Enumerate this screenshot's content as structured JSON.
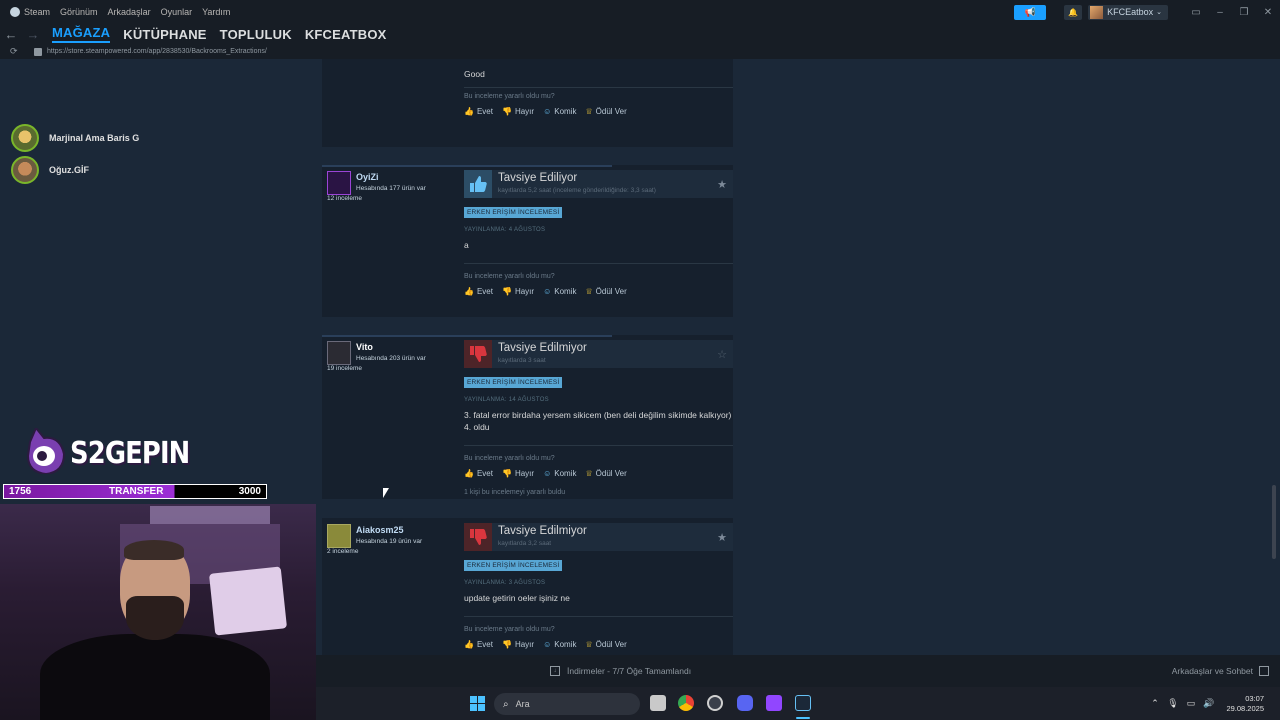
{
  "menu_bar": {
    "items": [
      "Steam",
      "Görünüm",
      "Arkadaşlar",
      "Oyunlar",
      "Yardım"
    ],
    "account_name": "KFCEatbox"
  },
  "nav": {
    "tabs": [
      "MAĞAZA",
      "KÜTÜPHANE",
      "TOPLULUK",
      "KFCEATBOX"
    ],
    "active_tab": "MAĞAZA",
    "url": "https://store.steampowered.com/app/2838530/Backrooms_Extractions/"
  },
  "friends": [
    {
      "name": "Marjinal Ama Baris G"
    },
    {
      "name": "Oğuz.GİF"
    }
  ],
  "partial_review": {
    "body": "Good",
    "helpful_question": "Bu inceleme yararlı oldu mu?",
    "actions": [
      "Evet",
      "Hayır",
      "Komik",
      "Ödül Ver"
    ]
  },
  "reviews": [
    {
      "user": "OyiZi",
      "games": "Hesabında 177 ürün var",
      "review_count": "12 inceleme",
      "verdict": "Tavsiye Ediliyor",
      "recommended": true,
      "hours": "kayıtlarda 5,2 saat (inceleme gönderildiğinde: 3,3 saat)",
      "badge": "ERKEN ERİŞİM İNCELEMESİ",
      "posted": "YAYINLANMA: 4 AĞUSTOS",
      "body": "a",
      "helpful_question": "Bu inceleme yararlı oldu mu?",
      "actions": [
        "Evet",
        "Hayır",
        "Komik",
        "Ödül Ver"
      ],
      "helpful_count": ""
    },
    {
      "user": "Vito",
      "games": "Hesabında 203 ürün var",
      "review_count": "19 inceleme",
      "verdict": "Tavsiye Edilmiyor",
      "recommended": false,
      "hours": "kayıtlarda 3 saat",
      "badge": "ERKEN ERİŞİM İNCELEMESİ",
      "posted": "YAYINLANMA: 14 AĞUSTOS",
      "body": "3. fatal error birdaha yersem sikicem (ben deli değilim sikimde kalkıyor) 4. oldu",
      "helpful_question": "Bu inceleme yararlı oldu mu?",
      "actions": [
        "Evet",
        "Hayır",
        "Komik",
        "Ödül Ver"
      ],
      "helpful_count": "1 kişi bu incelemeyi yararlı buldu"
    },
    {
      "user": "Aiakosm25",
      "games": "Hesabında 19 ürün var",
      "review_count": "2 inceleme",
      "verdict": "Tavsiye Edilmiyor",
      "recommended": false,
      "hours": "kayıtlarda 3,2 saat",
      "badge": "ERKEN ERİŞİM İNCELEMESİ",
      "posted": "YAYINLANMA: 3 AĞUSTOS",
      "body": "update getirin oeler işiniz ne",
      "helpful_question": "Bu inceleme yararlı oldu mu?",
      "actions": [
        "Evet",
        "Hayır",
        "Komik",
        "Ödül Ver"
      ],
      "helpful_count": ""
    }
  ],
  "overlay": {
    "logo_text": "S2GEPIN",
    "transfer_left": "1756",
    "transfer_label": "TRANSFER",
    "transfer_right": "3000"
  },
  "download_bar": {
    "status": "İndirmeler - 7/7 Öğe Tamamlandı",
    "friends_chat": "Arkadaşlar ve Sohbet"
  },
  "taskbar": {
    "search_placeholder": "Ara",
    "time": "03:07",
    "date": "29.08.2025"
  },
  "colors": {
    "accent": "#1a9fff",
    "background": "#1b2838",
    "badge": "#58a7d5",
    "recommended": "#66c0f4",
    "not_recommended": "#d9363e"
  }
}
